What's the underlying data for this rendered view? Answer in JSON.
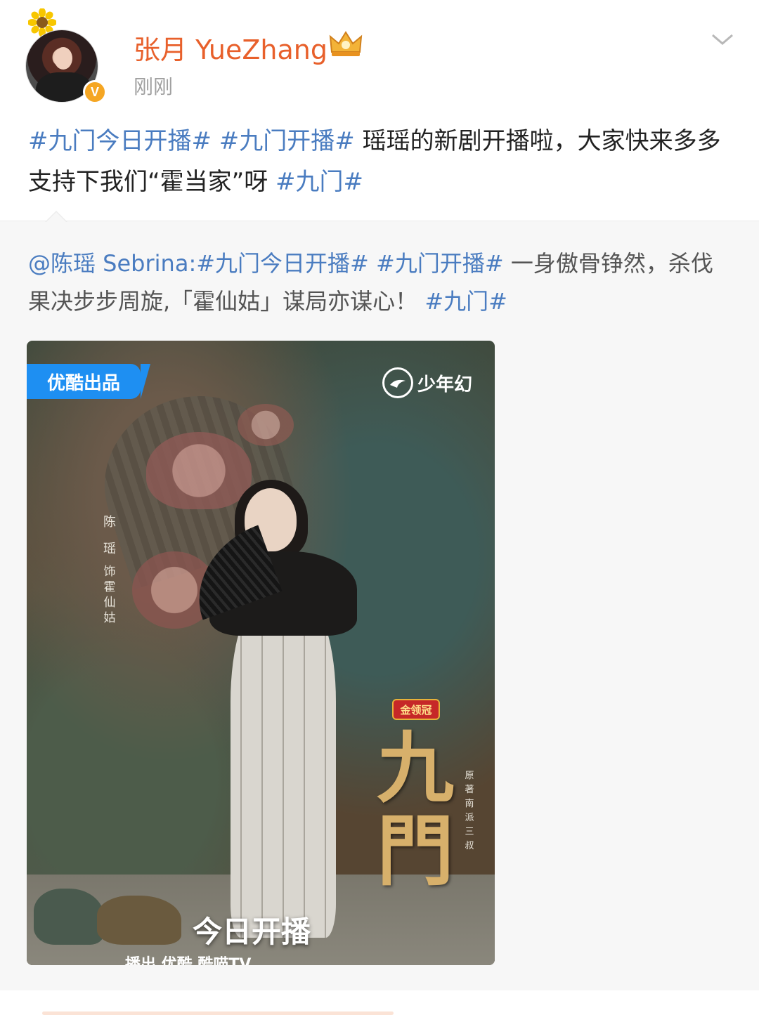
{
  "post": {
    "username": "张月 YueZhang",
    "timestamp": "刚刚",
    "text_parts": {
      "tag1": "#九门今日开播#",
      "tag2": "#九门开播#",
      "body1": "瑶瑶的新剧开播啦，大家快来多多支持下我们“霍当家”呀",
      "tag3": "#九门#"
    }
  },
  "repost": {
    "mention": "@陈瑶 Sebrina",
    "colon": ":",
    "tag1": "#九门今日开播#",
    "tag2": "#九门开播#",
    "body": "一身傲骨铮然，杀伐果决步步周旋,「霍仙姑」谋局亦谋心！",
    "tag3": "#九门#"
  },
  "poster": {
    "badge": "优酷出品",
    "brand": "少年幻",
    "cast_name": "陈瑶",
    "cast_role": "饰霍仙姑",
    "sponsor": "金领冠",
    "title": "九門",
    "author": "原著南派三叔",
    "premiere": "今日开播",
    "bottom_partial": "播出  优酷  酷喵TV"
  },
  "icons": {
    "avatar_decoration": "sunflower-icon",
    "verified": "verified-badge-icon",
    "member": "crown-icon",
    "menu": "chevron-down-icon"
  },
  "colors": {
    "username": "#e8602b",
    "hashtag": "#4a7cc0",
    "verified": "#f5a623",
    "youku_blue": "#1e8ff2"
  }
}
